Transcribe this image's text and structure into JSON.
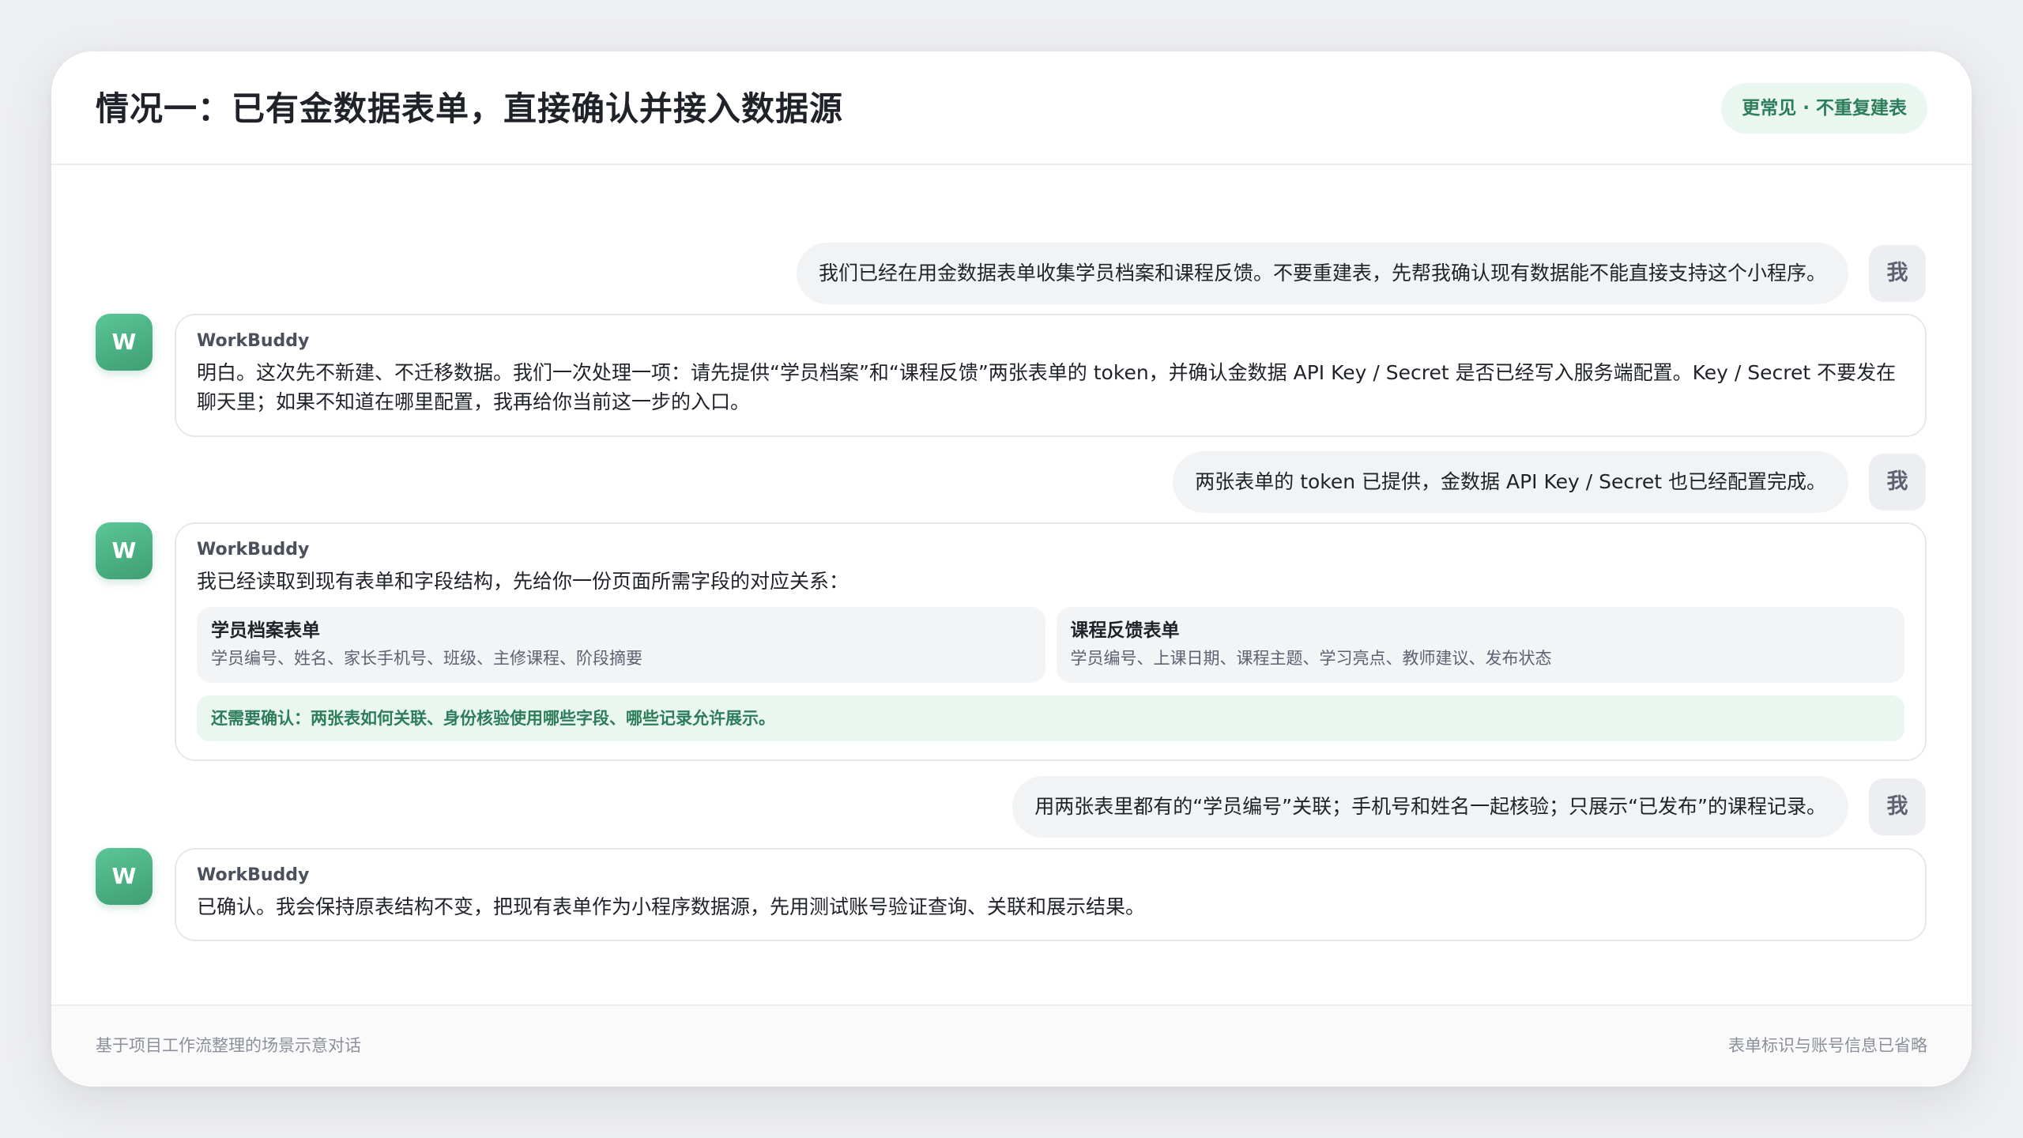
{
  "header": {
    "title": "情况一：已有金数据表单，直接确认并接入数据源",
    "badge": "更常见 · 不重复建表"
  },
  "user_avatar": "我",
  "bot": {
    "avatar": "W",
    "name": "WorkBuddy"
  },
  "messages": {
    "m1": "我们已经在用金数据表单收集学员档案和课程反馈。不要重建表，先帮我确认现有数据能不能直接支持这个小程序。",
    "m2": "明白。这次先不新建、不迁移数据。我们一次处理一项：请先提供“学员档案”和“课程反馈”两张表单的 token，并确认金数据 API Key / Secret 是否已经写入服务端配置。Key / Secret 不要发在聊天里；如果不知道在哪里配置，我再给你当前这一步的入口。",
    "m3": "两张表单的 token 已提供，金数据 API Key / Secret 也已经配置完成。",
    "m4": "我已经读取到现有表单和字段结构，先给你一份页面所需字段的对应关系：",
    "m5": "用两张表里都有的“学员编号”关联；手机号和姓名一起核验；只展示“已发布”的课程记录。",
    "m6": "已确认。我会保持原表结构不变，把现有表单作为小程序数据源，先用测试账号验证查询、关联和展示结果。"
  },
  "forms": [
    {
      "title": "学员档案表单",
      "fields": "学员编号、姓名、家长手机号、班级、主修课程、阶段摘要"
    },
    {
      "title": "课程反馈表单",
      "fields": "学员编号、上课日期、课程主题、学习亮点、教师建议、发布状态"
    }
  ],
  "note": "还需要确认：两张表如何关联、身份核验使用哪些字段、哪些记录允许展示。",
  "footer": {
    "left": "基于项目工作流整理的场景示意对话",
    "right": "表单标识与账号信息已省略"
  },
  "colors": {
    "accent": "#3e9f73",
    "accent_soft": "#eaf6f0",
    "accent_text": "#2d7d5a"
  }
}
